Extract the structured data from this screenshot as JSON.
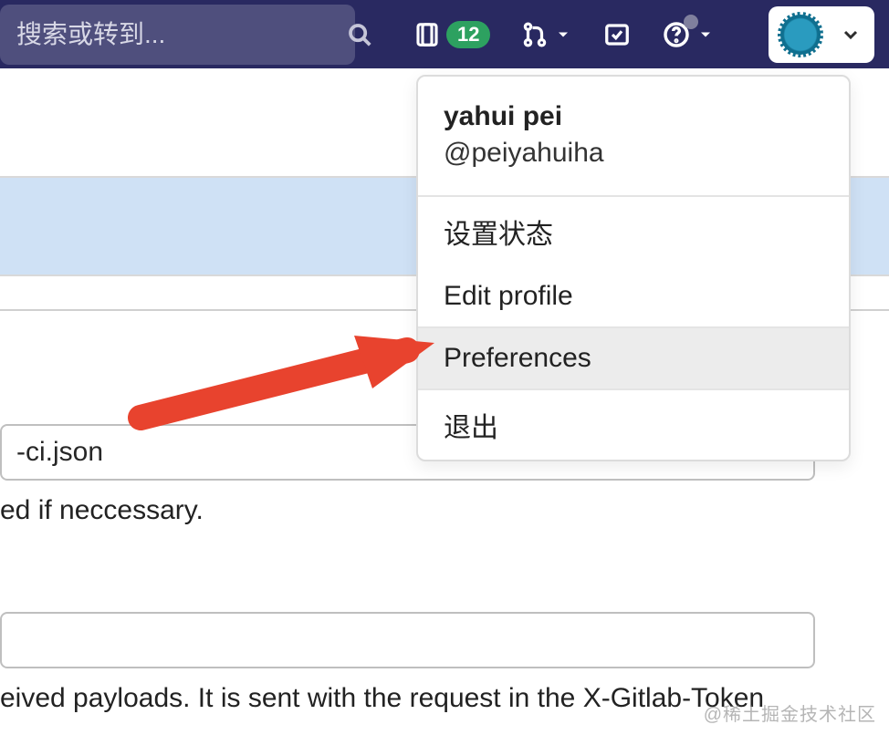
{
  "topbar": {
    "search_placeholder": "搜索或转到...",
    "issues_badge": "12"
  },
  "dropdown": {
    "display_name": "yahui pei",
    "handle": "@peiyahuiha",
    "set_status": "设置状态",
    "edit_profile": "Edit profile",
    "preferences": "Preferences",
    "sign_out": "退出"
  },
  "page": {
    "field1_value": "-ci.json",
    "field1_help": "ed if neccessary.",
    "field2_help": "eived payloads. It is sent with the request in the X-Gitlab-Token"
  },
  "watermark": "@稀土掘金技术社区"
}
